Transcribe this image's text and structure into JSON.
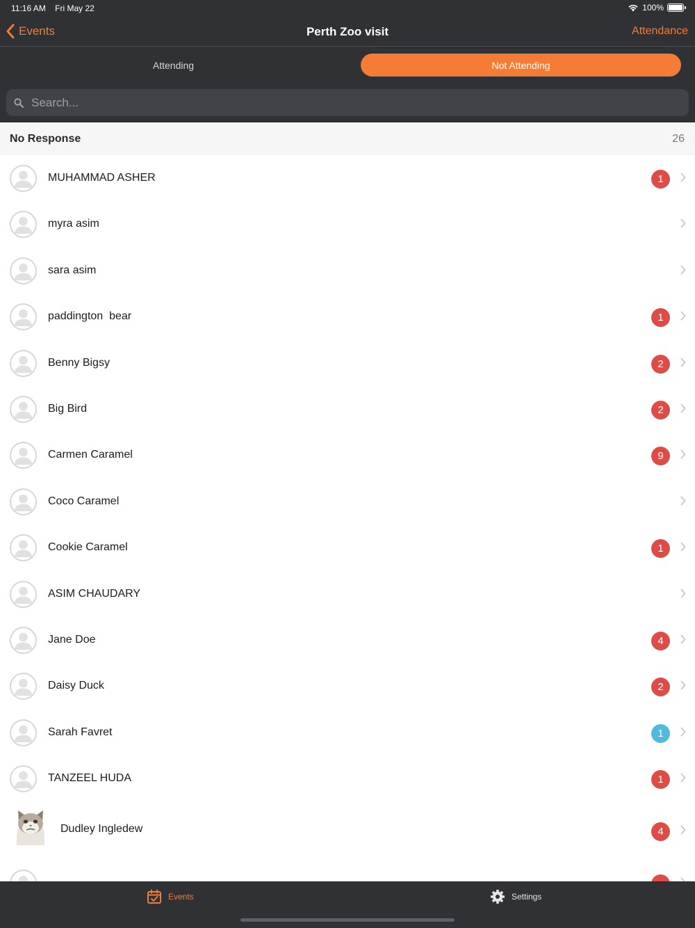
{
  "status_bar": {
    "time": "11:16 AM",
    "date": "Fri May 22",
    "battery": "100%"
  },
  "nav": {
    "back_label": "Events",
    "title": "Perth Zoo visit",
    "right_label": "Attendance"
  },
  "segments": [
    {
      "label": "Attending",
      "selected": false
    },
    {
      "label": "Not Attending",
      "selected": true
    }
  ],
  "search": {
    "placeholder": "Search..."
  },
  "section": {
    "title": "No Response",
    "count": "26"
  },
  "members": [
    {
      "name": "MUHAMMAD ASHER",
      "badge": "1",
      "badge_color": "red"
    },
    {
      "name": "myra asim",
      "badge": "",
      "badge_color": ""
    },
    {
      "name": "sara asim",
      "badge": "",
      "badge_color": ""
    },
    {
      "name": "paddington  bear",
      "badge": "1",
      "badge_color": "red"
    },
    {
      "name": "Benny Bigsy",
      "badge": "2",
      "badge_color": "red"
    },
    {
      "name": "Big Bird",
      "badge": "2",
      "badge_color": "red"
    },
    {
      "name": "Carmen Caramel",
      "badge": "9",
      "badge_color": "red"
    },
    {
      "name": "Coco Caramel",
      "badge": "",
      "badge_color": ""
    },
    {
      "name": "Cookie Caramel",
      "badge": "1",
      "badge_color": "red"
    },
    {
      "name": "ASIM CHAUDARY",
      "badge": "",
      "badge_color": ""
    },
    {
      "name": "Jane Doe",
      "badge": "4",
      "badge_color": "red"
    },
    {
      "name": "Daisy Duck",
      "badge": "2",
      "badge_color": "red"
    },
    {
      "name": "Sarah Favret",
      "badge": "1",
      "badge_color": "blue"
    },
    {
      "name": "TANZEEL HUDA",
      "badge": "1",
      "badge_color": "red"
    },
    {
      "name": "Dudley Ingledew",
      "badge": "4",
      "badge_color": "red",
      "photo": "cat-photo"
    }
  ],
  "tabs": [
    {
      "label": "Events",
      "icon": "calendar-check-icon",
      "active": true
    },
    {
      "label": "Settings",
      "icon": "gear-icon",
      "active": false
    }
  ],
  "colors": {
    "accent": "#f57c35",
    "bar": "#303135",
    "badge_red": "#de4c47",
    "badge_blue": "#4fbadb"
  }
}
